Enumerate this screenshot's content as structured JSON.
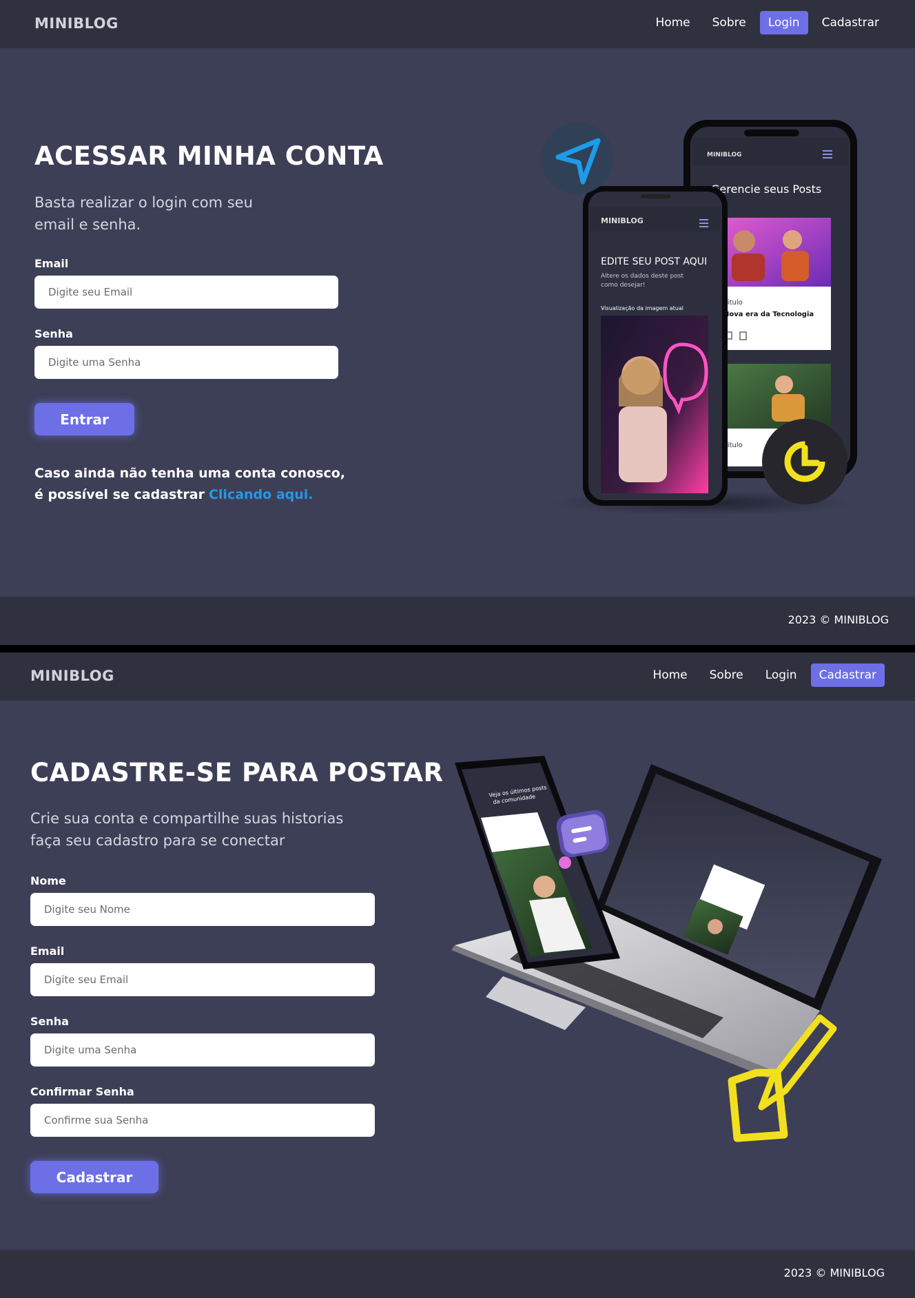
{
  "login_screen": {
    "nav": {
      "brand": "MINIBLOG",
      "links": [
        {
          "label": "Home",
          "active": false
        },
        {
          "label": "Sobre",
          "active": false
        },
        {
          "label": "Login",
          "active": true
        },
        {
          "label": "Cadastrar",
          "active": false
        }
      ]
    },
    "title": "ACESSAR MINHA CONTA",
    "subtitle_line1": "Basta realizar o login com seu",
    "subtitle_line2": "email e senha.",
    "fields": [
      {
        "label": "Email",
        "placeholder": "Digite seu Email",
        "value": ""
      },
      {
        "label": "Senha",
        "placeholder": "Digite uma Senha",
        "value": ""
      }
    ],
    "submit_label": "Entrar",
    "signup_note_line1": "Caso ainda não tenha uma conta conosco,",
    "signup_note_line2": "é possível se cadastrar",
    "signup_link": "Clicando aqui.",
    "illustration": {
      "phone_back_brand": "MINIBLOG",
      "phone_back_heading": "Gerencie seus Posts",
      "phone_back_card_label": "Titulo",
      "phone_back_card_title": "Nova era da Tecnologia",
      "phone_back_card2_label": "Titulo",
      "phone_front_brand": "MINIBLOG",
      "phone_front_heading": "EDITE SEU POST AQUI",
      "phone_front_sub_line1": "Altere os dados deste post",
      "phone_front_sub_line2": "como desejar!",
      "phone_front_caption": "Visualização da imagem atual",
      "icon_color_send": "#1e9be9",
      "icon_color_chart": "#f2e01f"
    },
    "footer": "2023 © MINIBLOG"
  },
  "register_screen": {
    "nav": {
      "brand": "MINIBLOG",
      "links": [
        {
          "label": "Home",
          "active": false
        },
        {
          "label": "Sobre",
          "active": false
        },
        {
          "label": "Login",
          "active": false
        },
        {
          "label": "Cadastrar",
          "active": true
        }
      ]
    },
    "title": "CADASTRE-SE PARA POSTAR",
    "subtitle_line1": "Crie sua conta e compartilhe suas historias",
    "subtitle_line2": "faça seu cadastro para se conectar",
    "fields": [
      {
        "label": "Nome",
        "placeholder": "Digite seu Nome",
        "value": ""
      },
      {
        "label": "Email",
        "placeholder": "Digite seu Email",
        "value": ""
      },
      {
        "label": "Senha",
        "placeholder": "Digite uma Senha",
        "value": ""
      },
      {
        "label": "Confirmar Senha",
        "placeholder": "Confirme sua Senha",
        "value": ""
      }
    ],
    "submit_label": "Cadastrar",
    "illustration": {
      "phone_heading_line1": "Veja os últimos posts",
      "phone_heading_line2": "da comunidade",
      "icon_color_chat": "#8f7ee0",
      "icon_color_edit": "#f2e01f"
    },
    "footer": "2023 © MINIBLOG"
  },
  "colors": {
    "background": "#3d3f57",
    "navbar": "#30313f",
    "accent": "#6c6fe6",
    "link": "#1e9be9",
    "highlight_yellow": "#f2e01f"
  }
}
